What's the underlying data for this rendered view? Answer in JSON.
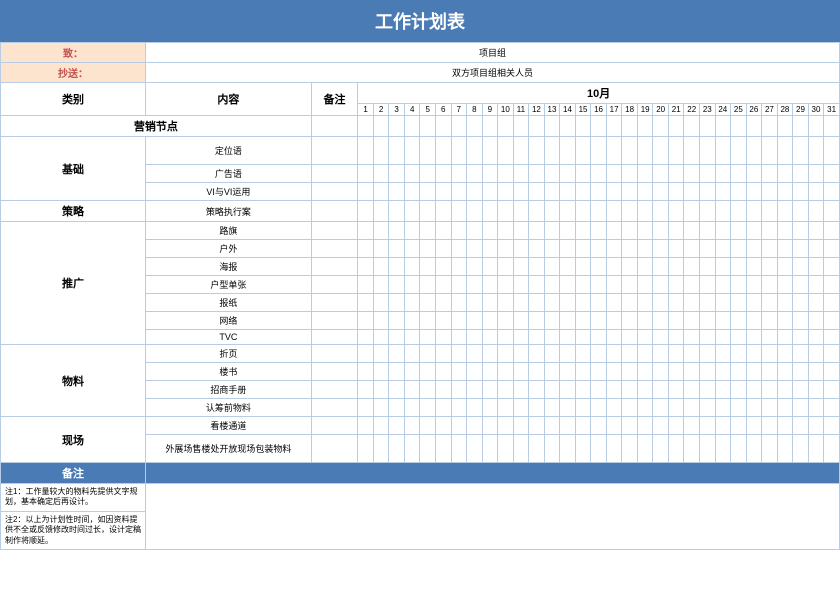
{
  "title": "工作计划表",
  "header": {
    "to_label": "致：",
    "to_value": "项目组",
    "cc_label": "抄送：",
    "cc_value": "双方项目组相关人员"
  },
  "columns": {
    "category": "类别",
    "content": "内容",
    "remark": "备注",
    "month": "10月"
  },
  "days": [
    "1",
    "2",
    "3",
    "4",
    "5",
    "6",
    "7",
    "8",
    "9",
    "10",
    "11",
    "12",
    "13",
    "14",
    "15",
    "16",
    "17",
    "18",
    "19",
    "20",
    "21",
    "22",
    "23",
    "24",
    "25",
    "26",
    "27",
    "28",
    "29",
    "30",
    "31"
  ],
  "section_marketing": "营销节点",
  "categories": {
    "basic": "基础",
    "strategy": "策略",
    "promo": "推广",
    "material": "物料",
    "onsite": "现场"
  },
  "items": {
    "basic1": "定位语",
    "basic2": "广告语",
    "basic3": "VI与VI运用",
    "strategy1": "策略执行案",
    "promo1": "路旗",
    "promo2": "户外",
    "promo3": "海报",
    "promo4": "户型单张",
    "promo5": "报纸",
    "promo6": "网络",
    "promo7": "TVC",
    "material1": "折页",
    "material2": "楼书",
    "material3": "招商手册",
    "material4": "认筹前物料",
    "onsite1": "看楼通道",
    "onsite2": "外展场售楼处开放现场包装物料"
  },
  "notes": {
    "header": "备注",
    "note1": "注1：工作量较大的物料先提供文字规划，基本确定后再设计。",
    "note2": "注2：以上为计划性时间，如因资料提供不全或反馈修改时间过长，设计定稿制作将顺延。"
  }
}
